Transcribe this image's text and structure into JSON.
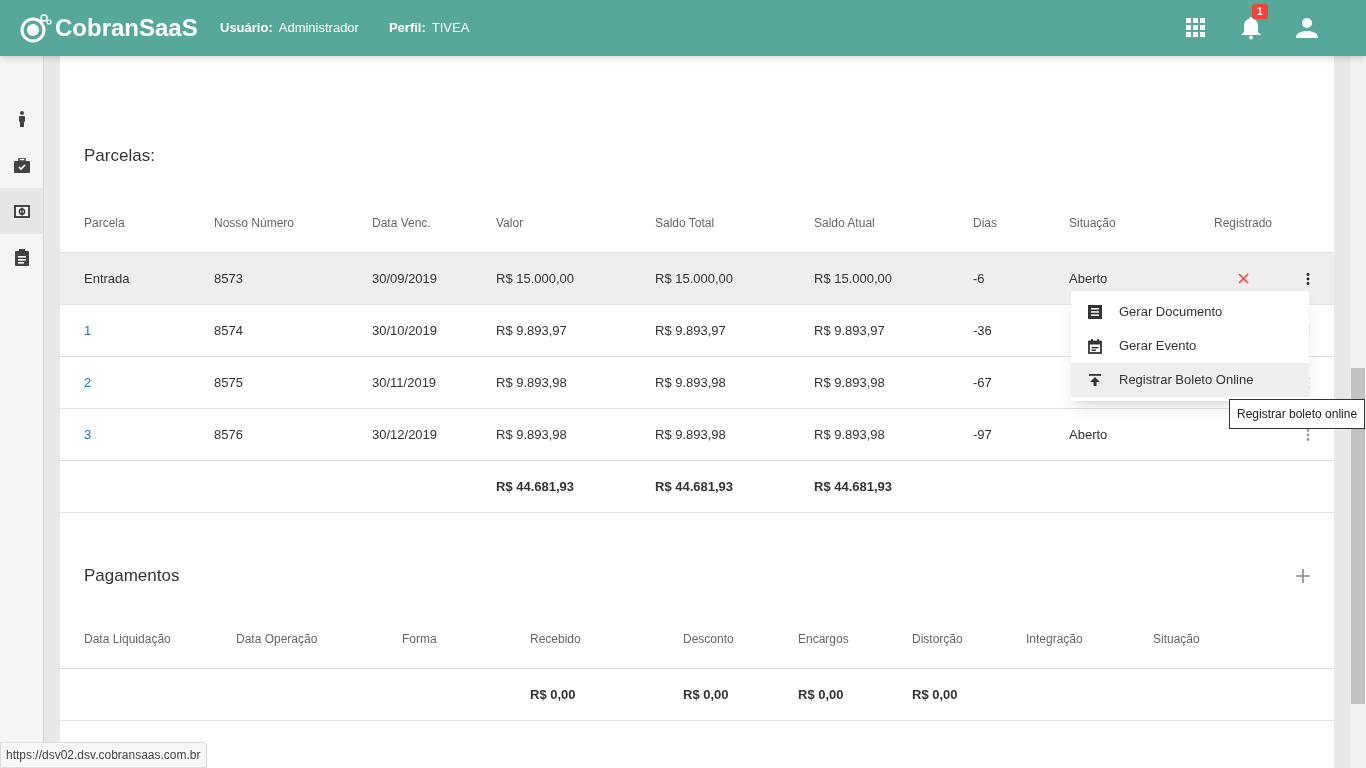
{
  "header": {
    "logo": "CobranSaaS",
    "user_label": "Usuário:",
    "user": "Administrador",
    "profile_label": "Perfil:",
    "profile": "TIVEA",
    "notifications": "1"
  },
  "sidebar": {
    "items": [
      {
        "kind": "person",
        "selected": false
      },
      {
        "kind": "briefcase",
        "selected": false
      },
      {
        "kind": "money",
        "selected": true
      },
      {
        "kind": "clipboard",
        "selected": false
      }
    ]
  },
  "parcelas": {
    "title": "Parcelas:",
    "columns": [
      "Parcela",
      "Nosso Número",
      "Data Venc.",
      "Valor",
      "Saldo Total",
      "Saldo Atual",
      "Dias",
      "Situação",
      "Registrado"
    ],
    "rows": [
      {
        "cells": [
          "Entrada",
          "8573",
          "30/09/2019",
          "R$ 15.000,00",
          "R$ 15.000,00",
          "R$ 15.000,00",
          "-6",
          "Aberto"
        ],
        "registered": false,
        "selected": true
      },
      {
        "cells": [
          "1",
          "8574",
          "30/10/2019",
          "R$ 9.893,97",
          "R$ 9.893,97",
          "R$ 9.893,97",
          "-36"
        ],
        "selected": false
      },
      {
        "cells": [
          "2",
          "8575",
          "30/11/2019",
          "R$ 9.893,98",
          "R$ 9.893,98",
          "R$ 9.893,98",
          "-67"
        ],
        "selected": false
      },
      {
        "cells": [
          "3",
          "8576",
          "30/12/2019",
          "R$ 9.893,98",
          "R$ 9.893,98",
          "R$ 9.893,98",
          "-97",
          "Aberto"
        ],
        "selected": false
      }
    ],
    "totals": [
      "R$ 44.681,93",
      "R$ 44.681,93",
      "R$ 44.681,93"
    ]
  },
  "menu": {
    "items": [
      {
        "kind": "document",
        "label": "Gerar Documento",
        "selected": false
      },
      {
        "kind": "event",
        "label": "Gerar Evento",
        "selected": false
      },
      {
        "kind": "upload",
        "label": "Registrar Boleto Online",
        "selected": true
      }
    ]
  },
  "tooltip": "Registrar boleto online",
  "pagamentos": {
    "title": "Pagamentos",
    "columns": [
      "Data Liquidação",
      "Data Operação",
      "Forma",
      "Recebido",
      "Desconto",
      "Encargos",
      "Distorção",
      "Integração",
      "Situação"
    ],
    "totals": [
      "R$ 0,00",
      "R$ 0,00",
      "R$ 0,00",
      "R$ 0,00"
    ]
  },
  "status_url": "https://dsv02.dsv.cobransaas.com.br"
}
